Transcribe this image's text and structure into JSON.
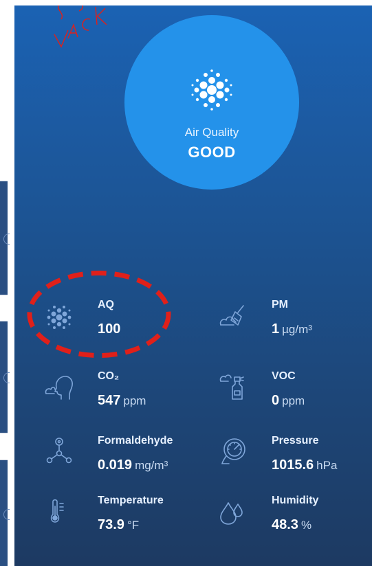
{
  "hero": {
    "label": "Air Quality",
    "status": "GOOD",
    "icon": "air-quality-dots-icon"
  },
  "metrics": {
    "aq": {
      "name": "AQ",
      "value": "100",
      "unit": "",
      "icon": "air-quality-dots-icon"
    },
    "pm": {
      "name": "PM",
      "value": "1",
      "unit": "µg/m³",
      "icon": "broom-cloud-icon"
    },
    "co2": {
      "name": "CO₂",
      "value": "547",
      "unit": "ppm",
      "icon": "head-breath-icon"
    },
    "voc": {
      "name": "VOC",
      "value": "0",
      "unit": "ppm",
      "icon": "spray-bottle-icon"
    },
    "formaldehyde": {
      "name": "Formaldehyde",
      "value": "0.019",
      "unit": "mg/m³",
      "icon": "molecule-icon"
    },
    "pressure": {
      "name": "Pressure",
      "value": "1015.6",
      "unit": "hPa",
      "icon": "gauge-icon"
    },
    "temperature": {
      "name": "Temperature",
      "value": "73.9",
      "unit": "°F",
      "icon": "thermometer-icon"
    },
    "humidity": {
      "name": "Humidity",
      "value": "48.3",
      "unit": "%",
      "icon": "water-drops-icon"
    }
  },
  "annotation": {
    "color": "#e0201a"
  },
  "colors": {
    "panel_top": "#1b62b3",
    "panel_bottom": "#1d3a62",
    "hero_circle": "#2492ea"
  }
}
